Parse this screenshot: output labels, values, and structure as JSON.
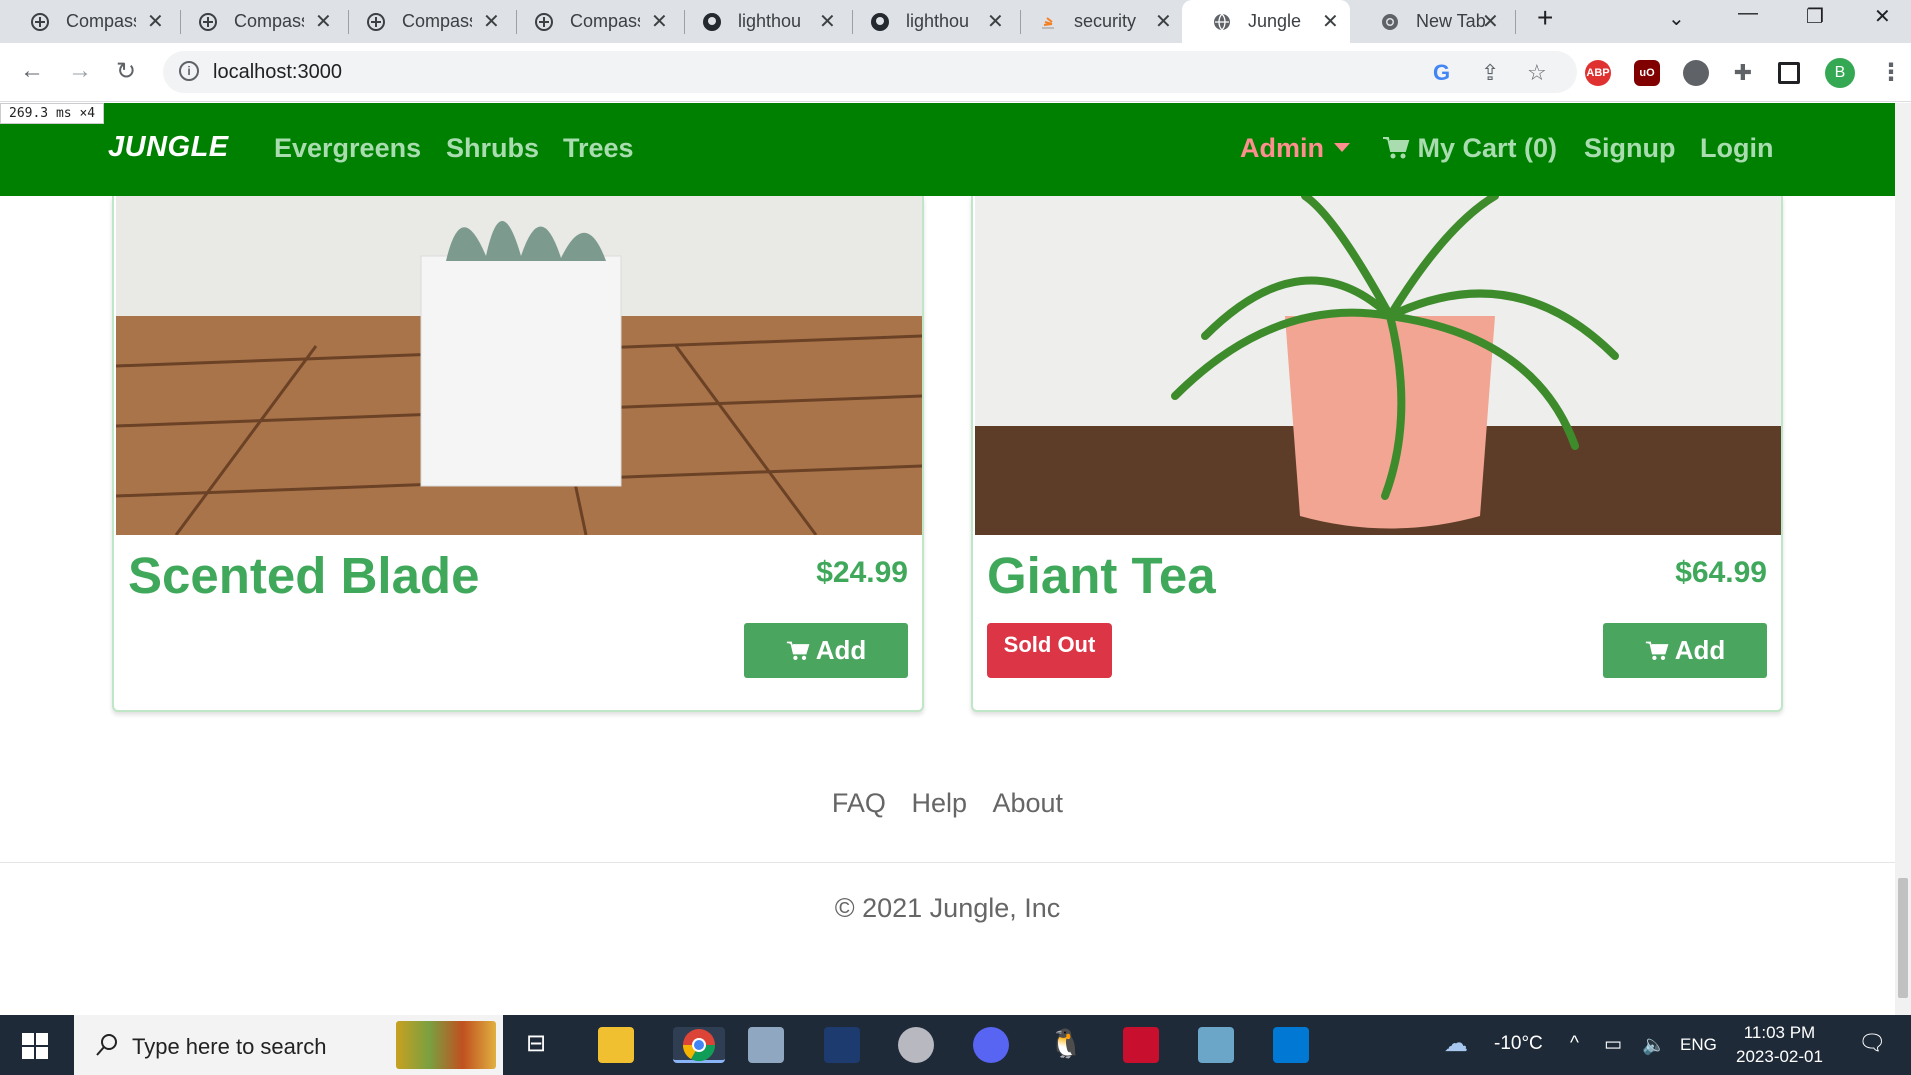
{
  "browser": {
    "tabs": [
      {
        "label": "Compass",
        "icon": "compass-icon"
      },
      {
        "label": "Compass",
        "icon": "compass-icon"
      },
      {
        "label": "Compass",
        "icon": "compass-icon"
      },
      {
        "label": "Compass",
        "icon": "compass-icon"
      },
      {
        "label": "lighthou",
        "icon": "github-icon"
      },
      {
        "label": "lighthou",
        "icon": "github-icon"
      },
      {
        "label": "security",
        "icon": "stackoverflow-icon"
      },
      {
        "label": "Jungle",
        "icon": "globe-icon",
        "active": true
      },
      {
        "label": "New Tab",
        "icon": "chrome-icon"
      }
    ],
    "url": "localhost:3000",
    "extensions": [
      "ABP",
      "uO"
    ],
    "profile_initial": "B"
  },
  "perf_overlay": "269.3 ms ×4",
  "site": {
    "brand": "JUNGLE",
    "nav_left": [
      "Evergreens",
      "Shrubs",
      "Trees"
    ],
    "nav_right": {
      "admin": "Admin",
      "cart": "My Cart (0)",
      "signup": "Signup",
      "login": "Login"
    }
  },
  "products": [
    {
      "name": "Scented Blade",
      "price": "$24.99",
      "add_label": "Add",
      "sold_out": false
    },
    {
      "name": "Giant Tea",
      "price": "$64.99",
      "add_label": "Add",
      "sold_out": true,
      "sold_out_label": "Sold Out"
    }
  ],
  "footer": {
    "links": [
      "FAQ",
      "Help",
      "About"
    ],
    "copyright": "© 2021 Jungle, Inc"
  },
  "taskbar": {
    "search_placeholder": "Type here to search",
    "weather": "-10°C",
    "language": "ENG",
    "time": "11:03 PM",
    "date": "2023-02-01"
  },
  "colors": {
    "nav_green": "#008000",
    "product_green": "#3fa85b",
    "sold_out_red": "#dc3545",
    "admin_pink": "#ff8f8f"
  }
}
